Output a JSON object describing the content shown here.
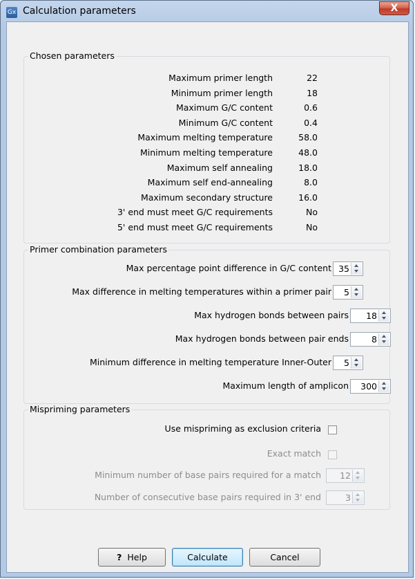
{
  "window": {
    "title": "Calculation parameters",
    "app_icon_text": "Gx",
    "close_symbol": "X"
  },
  "chosen": {
    "title": "Chosen parameters",
    "rows": [
      {
        "label": "Maximum primer length",
        "value": "22"
      },
      {
        "label": "Minimum primer length",
        "value": "18"
      },
      {
        "label": "Maximum G/C content",
        "value": "0.6"
      },
      {
        "label": "Minimum G/C content",
        "value": "0.4"
      },
      {
        "label": "Maximum melting temperature",
        "value": "58.0"
      },
      {
        "label": "Minimum melting temperature",
        "value": "48.0"
      },
      {
        "label": "Maximum self annealing",
        "value": "18.0"
      },
      {
        "label": "Maximum self end-annealing",
        "value": "8.0"
      },
      {
        "label": "Maximum secondary structure",
        "value": "16.0"
      },
      {
        "label": "3' end must meet G/C requirements",
        "value": "No"
      },
      {
        "label": "5' end must meet G/C requirements",
        "value": "No"
      }
    ]
  },
  "combination": {
    "title": "Primer combination parameters",
    "rows": [
      {
        "label": "Max percentage point difference in G/C content",
        "value": "35"
      },
      {
        "label": "Max difference in melting temperatures within a primer pair",
        "value": "5"
      },
      {
        "label": "Max hydrogen bonds between pairs",
        "value": "18"
      },
      {
        "label": "Max hydrogen bonds between pair ends",
        "value": "8"
      },
      {
        "label": "Minimum difference in melting temperature Inner-Outer",
        "value": "5"
      },
      {
        "label": "Maximum length of amplicon",
        "value": "300"
      }
    ]
  },
  "mispriming": {
    "title": "Mispriming parameters",
    "use_label": "Use mispriming as exclusion criteria",
    "exact_label": "Exact match",
    "min_pairs_label": "Minimum number of base pairs required for a match",
    "min_pairs_value": "12",
    "consecutive_label": "Number of consecutive base pairs required in 3' end",
    "consecutive_value": "3"
  },
  "buttons": {
    "help_symbol": "?",
    "help": "Help",
    "calculate": "Calculate",
    "cancel": "Cancel"
  },
  "colors": {
    "title_bar": "#b3c9e4",
    "close_button": "#c0392b",
    "dialog_bg": "#f0f0f0"
  }
}
